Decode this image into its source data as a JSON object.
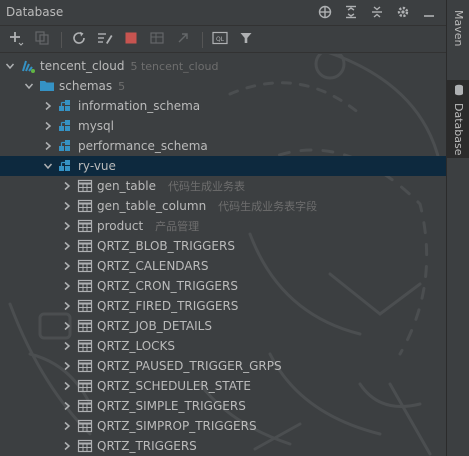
{
  "window": {
    "title": "Database"
  },
  "titlebar_icons": [
    "globe-icon",
    "expand-all-icon",
    "collapse-all-icon",
    "gear-icon",
    "minimize-icon"
  ],
  "toolbar": {
    "tools": [
      {
        "name": "add-icon",
        "dim": false
      },
      {
        "name": "copy-icon",
        "dim": true
      },
      {
        "name": "refresh-icon",
        "dim": false
      },
      {
        "name": "properties-icon",
        "dim": false
      },
      {
        "name": "stop-icon",
        "dim": false
      },
      {
        "name": "table-editor-icon",
        "dim": true
      },
      {
        "name": "jump-to-source-icon",
        "dim": true
      },
      {
        "name": "sql-console-icon",
        "dim": false
      },
      {
        "name": "filter-icon",
        "dim": false
      }
    ]
  },
  "right_tabs": [
    {
      "label": "Maven",
      "active": false
    },
    {
      "label": "Database",
      "active": true
    }
  ],
  "colors": {
    "background": "#3c3f41",
    "selection": "#0d293e",
    "text": "#bbbbbb",
    "hint": "#6e6e6e",
    "folder": "#3592c4",
    "accent_stop": "#c75450"
  },
  "tree": [
    {
      "depth": 0,
      "arrow": "down",
      "icon": "datasource-icon",
      "label": "tencent_cloud",
      "hint": "5  tencent_cloud"
    },
    {
      "depth": 1,
      "arrow": "down",
      "icon": "folder-icon",
      "label": "schemas",
      "hint": "5"
    },
    {
      "depth": 2,
      "arrow": "right",
      "icon": "schema-icon",
      "label": "information_schema",
      "hint": ""
    },
    {
      "depth": 2,
      "arrow": "right",
      "icon": "schema-icon",
      "label": "mysql",
      "hint": ""
    },
    {
      "depth": 2,
      "arrow": "right",
      "icon": "schema-icon",
      "label": "performance_schema",
      "hint": ""
    },
    {
      "depth": 2,
      "arrow": "down",
      "icon": "schema-icon",
      "label": "ry-vue",
      "hint": "",
      "selected": true
    },
    {
      "depth": 3,
      "arrow": "right",
      "icon": "table-icon",
      "label": "gen_table",
      "hint": "代码生成业务表"
    },
    {
      "depth": 3,
      "arrow": "right",
      "icon": "table-icon",
      "label": "gen_table_column",
      "hint": "代码生成业务表字段"
    },
    {
      "depth": 3,
      "arrow": "right",
      "icon": "table-icon",
      "label": "product",
      "hint": "产品管理"
    },
    {
      "depth": 3,
      "arrow": "right",
      "icon": "table-icon",
      "label": "QRTZ_BLOB_TRIGGERS",
      "hint": ""
    },
    {
      "depth": 3,
      "arrow": "right",
      "icon": "table-icon",
      "label": "QRTZ_CALENDARS",
      "hint": ""
    },
    {
      "depth": 3,
      "arrow": "right",
      "icon": "table-icon",
      "label": "QRTZ_CRON_TRIGGERS",
      "hint": ""
    },
    {
      "depth": 3,
      "arrow": "right",
      "icon": "table-icon",
      "label": "QRTZ_FIRED_TRIGGERS",
      "hint": ""
    },
    {
      "depth": 3,
      "arrow": "right",
      "icon": "table-icon",
      "label": "QRTZ_JOB_DETAILS",
      "hint": ""
    },
    {
      "depth": 3,
      "arrow": "right",
      "icon": "table-icon",
      "label": "QRTZ_LOCKS",
      "hint": ""
    },
    {
      "depth": 3,
      "arrow": "right",
      "icon": "table-icon",
      "label": "QRTZ_PAUSED_TRIGGER_GRPS",
      "hint": ""
    },
    {
      "depth": 3,
      "arrow": "right",
      "icon": "table-icon",
      "label": "QRTZ_SCHEDULER_STATE",
      "hint": ""
    },
    {
      "depth": 3,
      "arrow": "right",
      "icon": "table-icon",
      "label": "QRTZ_SIMPLE_TRIGGERS",
      "hint": ""
    },
    {
      "depth": 3,
      "arrow": "right",
      "icon": "table-icon",
      "label": "QRTZ_SIMPROP_TRIGGERS",
      "hint": ""
    },
    {
      "depth": 3,
      "arrow": "right",
      "icon": "table-icon",
      "label": "QRTZ_TRIGGERS",
      "hint": ""
    }
  ]
}
